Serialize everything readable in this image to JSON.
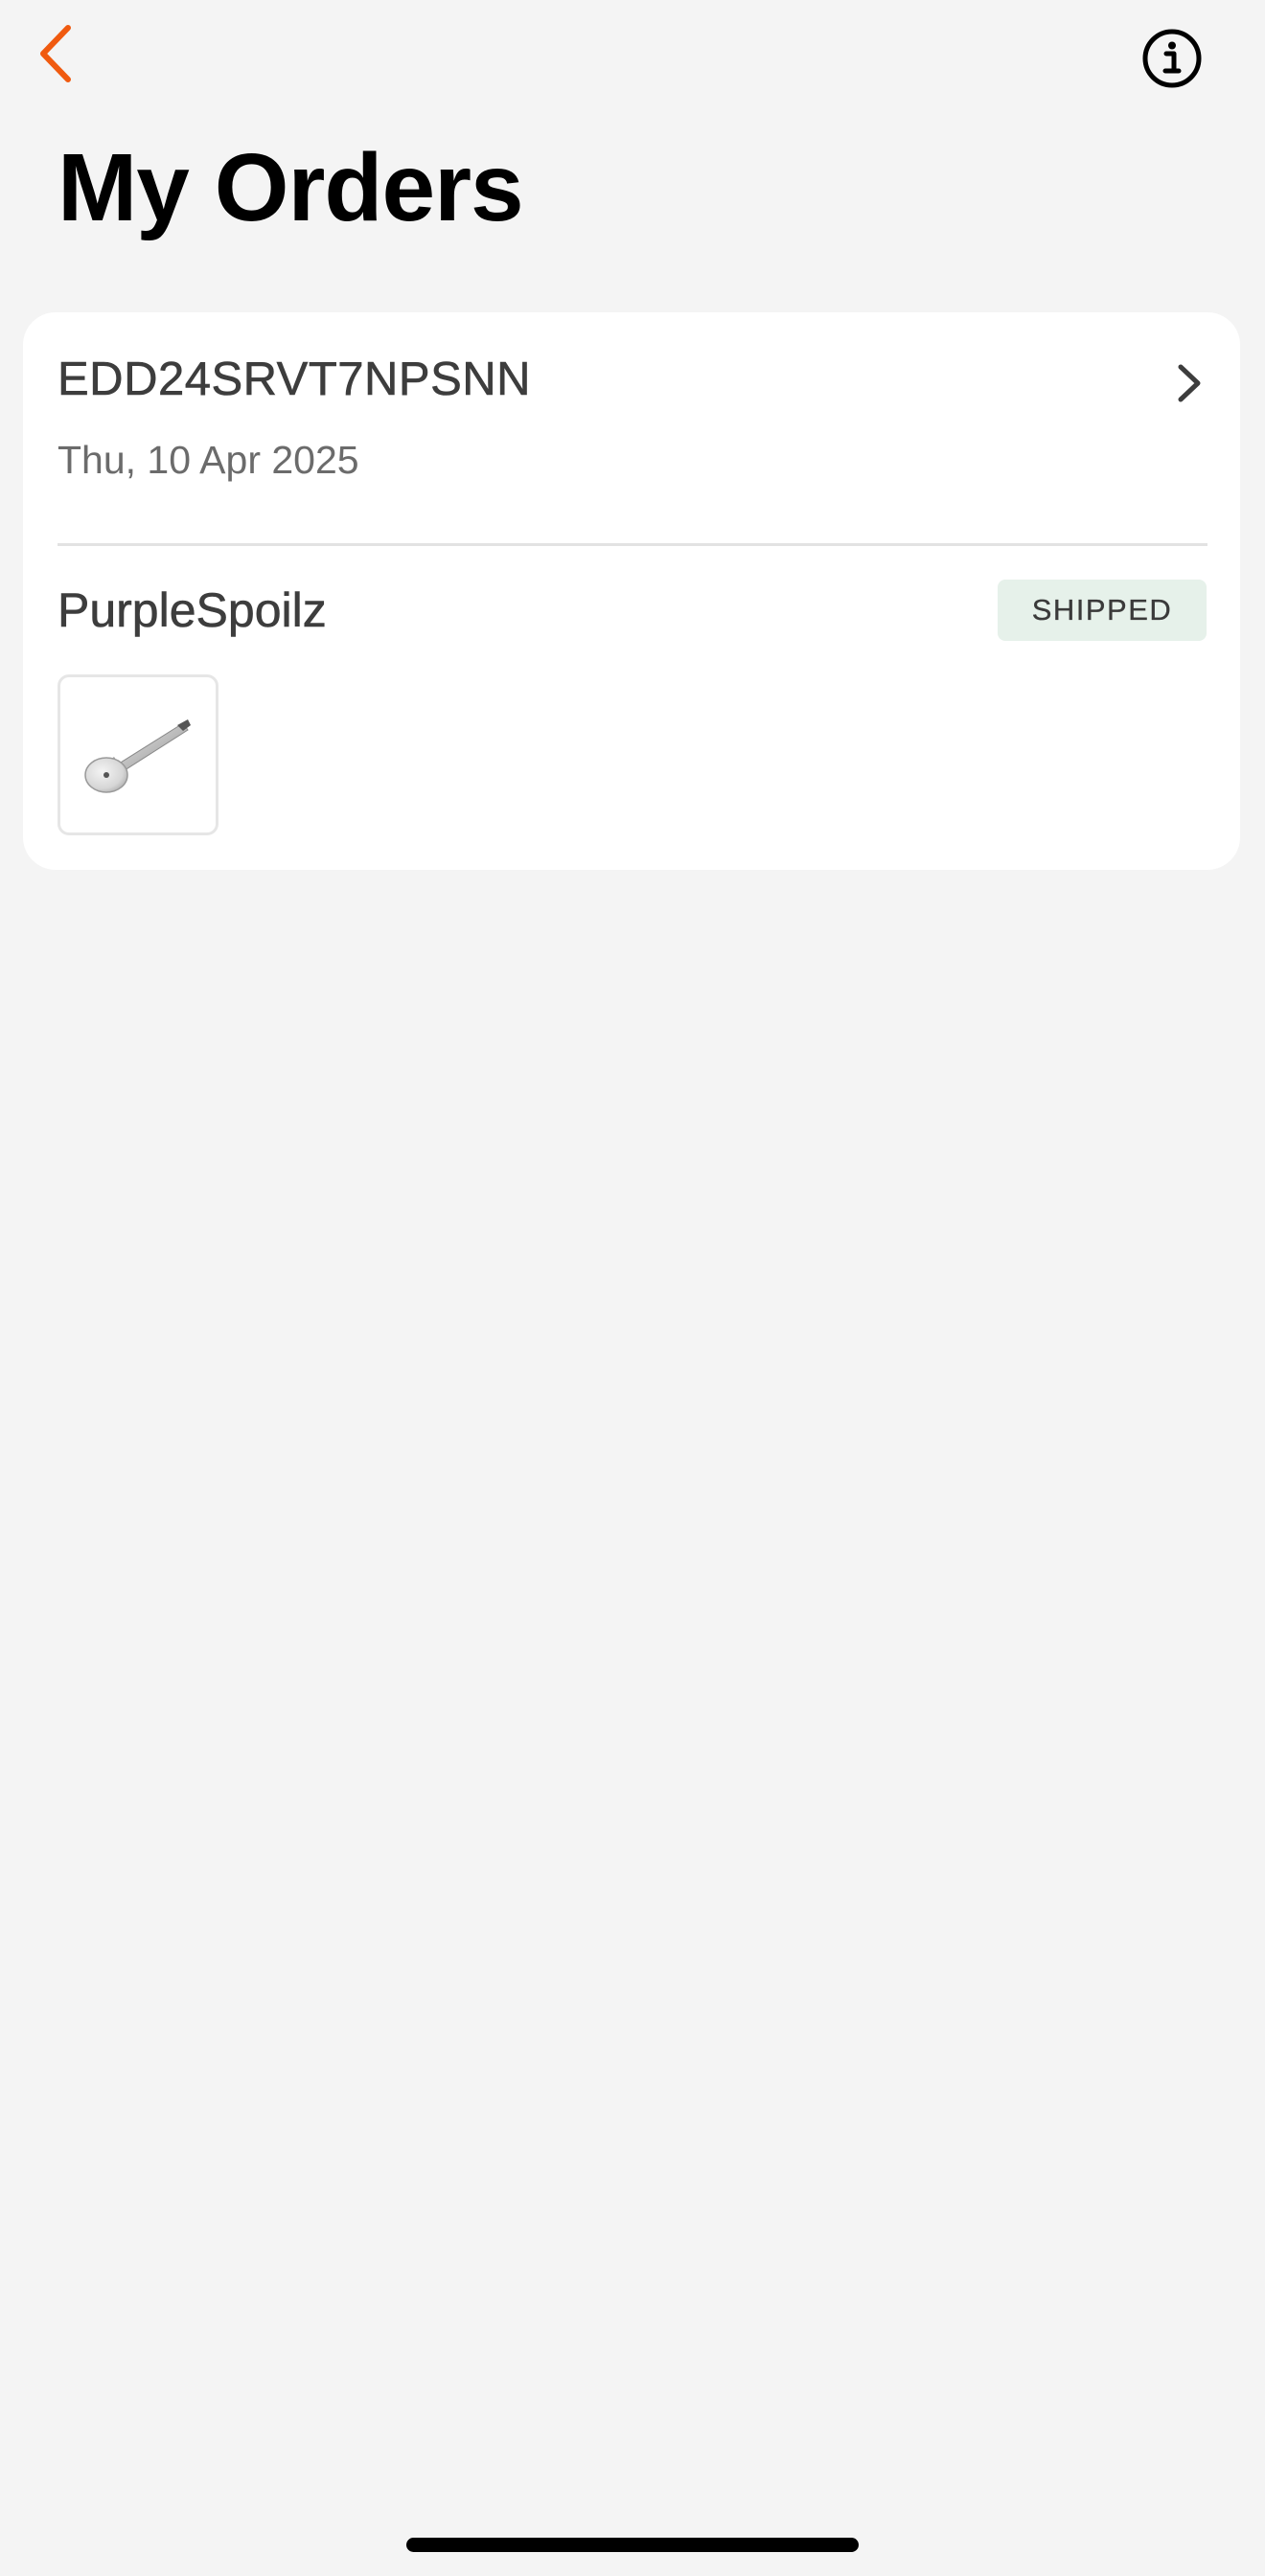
{
  "header": {
    "back_icon": "chevron-left-icon",
    "info_icon": "info-circle-icon",
    "accent_color": "#f05a0f"
  },
  "page": {
    "title": "My Orders"
  },
  "orders": [
    {
      "order_id": "EDD24SRVT7NPSNN",
      "date": "Thu, 10 Apr 2025",
      "seller": "PurpleSpoilz",
      "status": "SHIPPED",
      "status_bg": "#e6f1ea",
      "item_icon": "pizza-cutter-image"
    }
  ]
}
